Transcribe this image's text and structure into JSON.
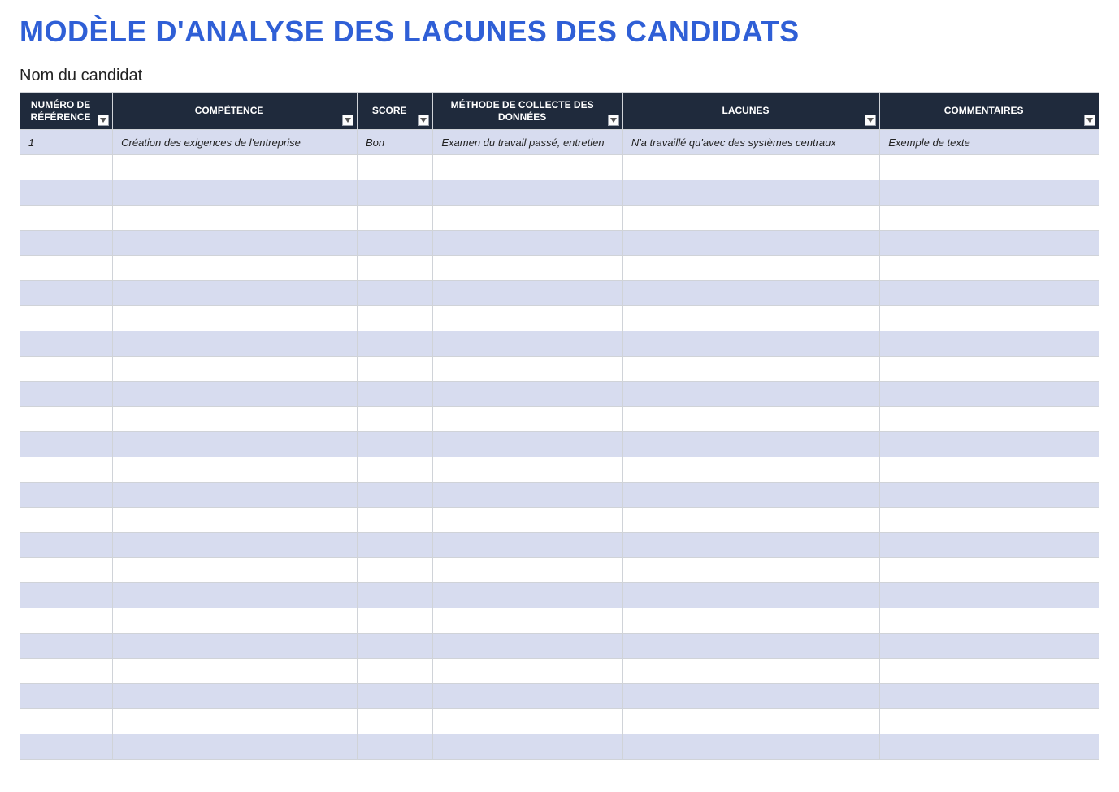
{
  "title": "MODÈLE D'ANALYSE DES LACUNES DES CANDIDATS",
  "subtitle": "Nom du candidat",
  "columns": [
    {
      "label": "NUMÉRO DE RÉFÉRENCE"
    },
    {
      "label": "COMPÉTENCE"
    },
    {
      "label": "SCORE"
    },
    {
      "label": "MÉTHODE DE COLLECTE DES DONNÉES"
    },
    {
      "label": "LACUNES"
    },
    {
      "label": "COMMENTAIRES"
    }
  ],
  "rows": [
    {
      "ref": "1",
      "competence": "Création des exigences de l'entreprise",
      "score": "Bon",
      "method": "Examen du travail passé, entretien",
      "gap": "N'a travaillé qu'avec des systèmes centraux",
      "comment": "Exemple de texte"
    },
    {
      "ref": "",
      "competence": "",
      "score": "",
      "method": "",
      "gap": "",
      "comment": ""
    },
    {
      "ref": "",
      "competence": "",
      "score": "",
      "method": "",
      "gap": "",
      "comment": ""
    },
    {
      "ref": "",
      "competence": "",
      "score": "",
      "method": "",
      "gap": "",
      "comment": ""
    },
    {
      "ref": "",
      "competence": "",
      "score": "",
      "method": "",
      "gap": "",
      "comment": ""
    },
    {
      "ref": "",
      "competence": "",
      "score": "",
      "method": "",
      "gap": "",
      "comment": ""
    },
    {
      "ref": "",
      "competence": "",
      "score": "",
      "method": "",
      "gap": "",
      "comment": ""
    },
    {
      "ref": "",
      "competence": "",
      "score": "",
      "method": "",
      "gap": "",
      "comment": ""
    },
    {
      "ref": "",
      "competence": "",
      "score": "",
      "method": "",
      "gap": "",
      "comment": ""
    },
    {
      "ref": "",
      "competence": "",
      "score": "",
      "method": "",
      "gap": "",
      "comment": ""
    },
    {
      "ref": "",
      "competence": "",
      "score": "",
      "method": "",
      "gap": "",
      "comment": ""
    },
    {
      "ref": "",
      "competence": "",
      "score": "",
      "method": "",
      "gap": "",
      "comment": ""
    },
    {
      "ref": "",
      "competence": "",
      "score": "",
      "method": "",
      "gap": "",
      "comment": ""
    },
    {
      "ref": "",
      "competence": "",
      "score": "",
      "method": "",
      "gap": "",
      "comment": ""
    },
    {
      "ref": "",
      "competence": "",
      "score": "",
      "method": "",
      "gap": "",
      "comment": ""
    },
    {
      "ref": "",
      "competence": "",
      "score": "",
      "method": "",
      "gap": "",
      "comment": ""
    },
    {
      "ref": "",
      "competence": "",
      "score": "",
      "method": "",
      "gap": "",
      "comment": ""
    },
    {
      "ref": "",
      "competence": "",
      "score": "",
      "method": "",
      "gap": "",
      "comment": ""
    },
    {
      "ref": "",
      "competence": "",
      "score": "",
      "method": "",
      "gap": "",
      "comment": ""
    },
    {
      "ref": "",
      "competence": "",
      "score": "",
      "method": "",
      "gap": "",
      "comment": ""
    },
    {
      "ref": "",
      "competence": "",
      "score": "",
      "method": "",
      "gap": "",
      "comment": ""
    },
    {
      "ref": "",
      "competence": "",
      "score": "",
      "method": "",
      "gap": "",
      "comment": ""
    },
    {
      "ref": "",
      "competence": "",
      "score": "",
      "method": "",
      "gap": "",
      "comment": ""
    },
    {
      "ref": "",
      "competence": "",
      "score": "",
      "method": "",
      "gap": "",
      "comment": ""
    },
    {
      "ref": "",
      "competence": "",
      "score": "",
      "method": "",
      "gap": "",
      "comment": ""
    }
  ]
}
